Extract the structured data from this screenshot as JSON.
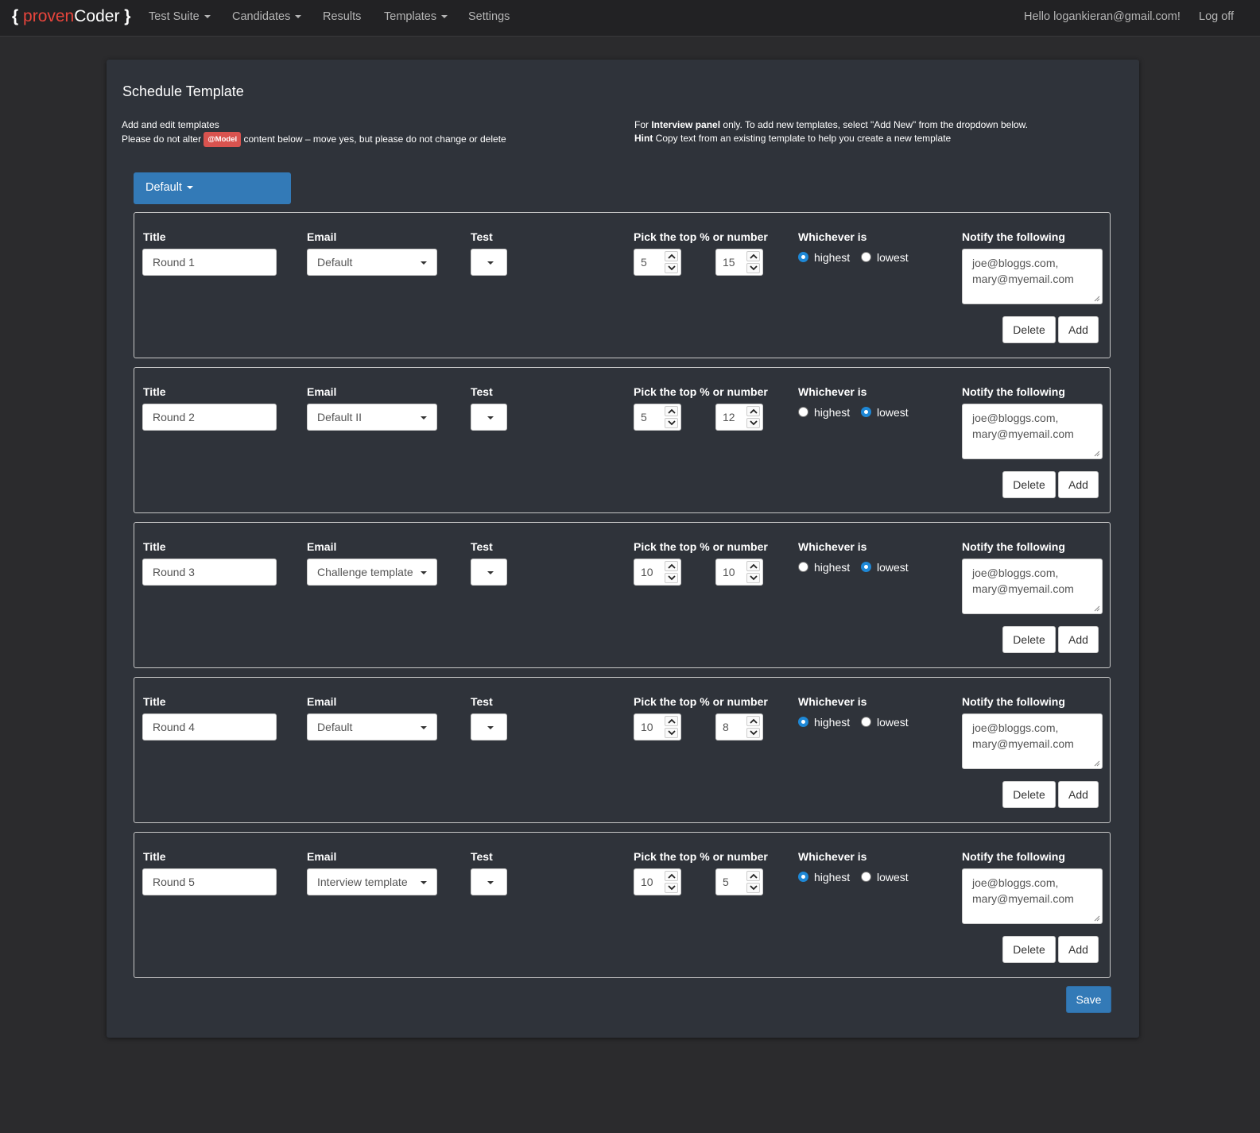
{
  "navbar": {
    "brand": {
      "open_brace": "{",
      "proven": "proven",
      "coder": "Coder",
      "close_brace": "}"
    },
    "items": [
      {
        "label": "Test Suite"
      },
      {
        "label": "Candidates"
      },
      {
        "label": "Results"
      },
      {
        "label": "Templates"
      },
      {
        "label": "Settings"
      }
    ],
    "greeting": "Hello logankieran@gmail.com!",
    "logoff": "Log off"
  },
  "page": {
    "title": "Schedule Template",
    "intro_left": {
      "line1": "Add and edit templates",
      "line2_pre": "Please do not alter",
      "badge": "@Model",
      "line2_post": "content below – move yes, but please do not change or delete"
    },
    "intro_right": {
      "line1_pre": "For",
      "line1_bold": "Interview panel",
      "line1_post": "only. To add new templates, select \"Add New\" from the dropdown below.",
      "line2_bold": "Hint",
      "line2_post": "Copy text from an existing template to help you create a new template"
    },
    "template_dropdown": "Default",
    "save_label": "Save"
  },
  "labels": {
    "title": "Title",
    "email": "Email",
    "test": "Test",
    "pick": "Pick the top % or number",
    "whichever": "Whichever is",
    "notify": "Notify the following",
    "highest": "highest",
    "lowest": "lowest",
    "delete": "Delete",
    "add": "Add"
  },
  "rounds": [
    {
      "title": "Round 1",
      "email": "Default",
      "percent": "5",
      "number": "15",
      "whichever": "highest",
      "notify_line1": "joe@bloggs.com,",
      "notify_line2": "mary@myemail.com"
    },
    {
      "title": "Round 2",
      "email": "Default II",
      "percent": "5",
      "number": "12",
      "whichever": "lowest",
      "notify_line1": "joe@bloggs.com,",
      "notify_line2": "mary@myemail.com"
    },
    {
      "title": "Round 3",
      "email": "Challenge template",
      "percent": "10",
      "number": "10",
      "whichever": "lowest",
      "notify_line1": "joe@bloggs.com,",
      "notify_line2": "mary@myemail.com"
    },
    {
      "title": "Round 4",
      "email": "Default",
      "percent": "10",
      "number": "8",
      "whichever": "highest",
      "notify_line1": "joe@bloggs.com,",
      "notify_line2": "mary@myemail.com"
    },
    {
      "title": "Round 5",
      "email": "Interview template",
      "percent": "10",
      "number": "5",
      "whichever": "highest",
      "notify_line1": "joe@bloggs.com,",
      "notify_line2": "mary@myemail.com"
    }
  ],
  "colors": {
    "accent": "#337ab7",
    "brand_red": "#e8453c",
    "badge": "#d9534f",
    "radio_checked": "#1e88d6"
  }
}
